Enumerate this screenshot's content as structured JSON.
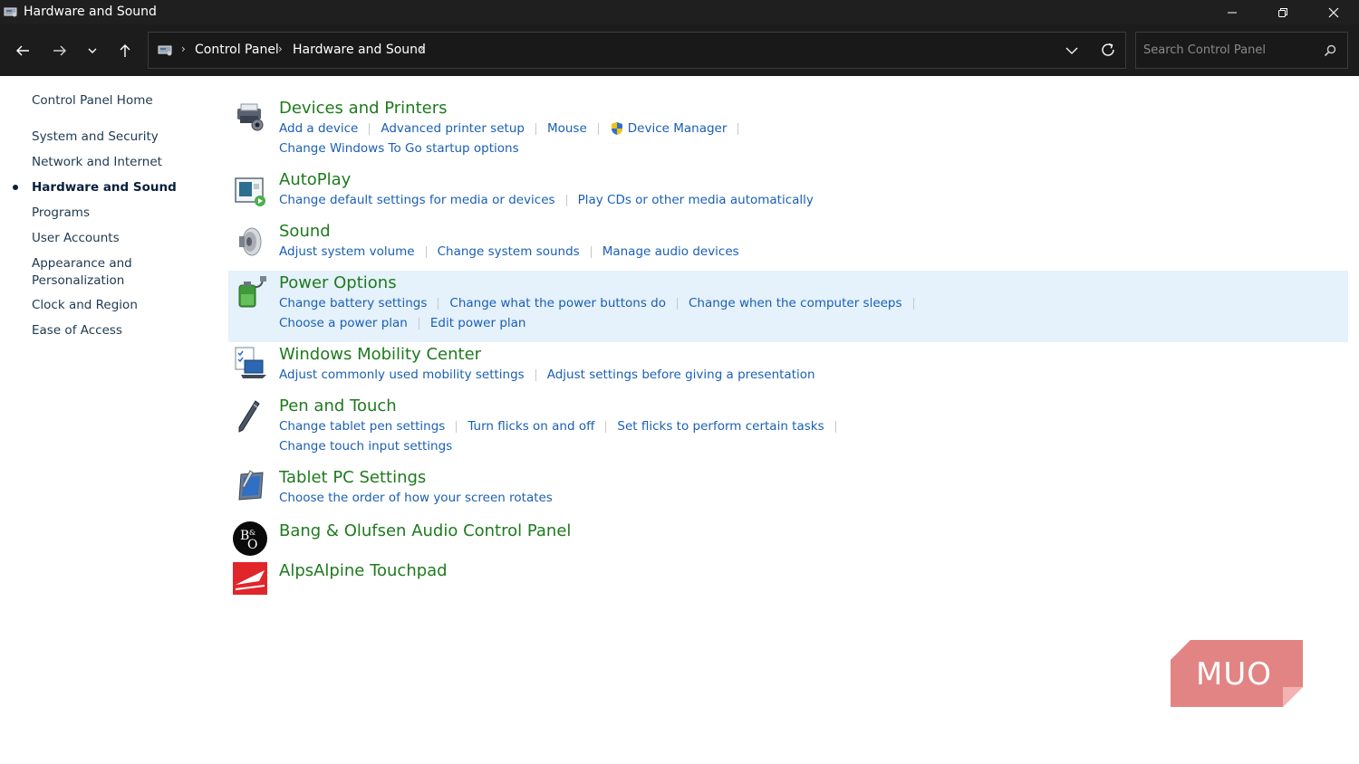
{
  "window": {
    "title": "Hardware and Sound",
    "controls": {
      "minimize": "minimize",
      "maximize": "restore",
      "close": "close"
    }
  },
  "address_bar": {
    "breadcrumbs": [
      "Control Panel",
      "Hardware and Sound"
    ],
    "search_placeholder": "Search Control Panel"
  },
  "sidebar": {
    "home": "Control Panel Home",
    "items": [
      {
        "label": "System and Security",
        "active": false
      },
      {
        "label": "Network and Internet",
        "active": false
      },
      {
        "label": "Hardware and Sound",
        "active": true
      },
      {
        "label": "Programs",
        "active": false
      },
      {
        "label": "User Accounts",
        "active": false
      },
      {
        "label": "Appearance and Personalization",
        "active": false
      },
      {
        "label": "Clock and Region",
        "active": false
      },
      {
        "label": "Ease of Access",
        "active": false
      }
    ]
  },
  "categories": [
    {
      "title": "Devices and Printers",
      "icon": "printer-camera-icon",
      "rows": [
        [
          "Add a device",
          "Advanced printer setup",
          "Mouse",
          "Device Manager"
        ],
        [
          "Change Windows To Go startup options"
        ]
      ]
    },
    {
      "title": "AutoPlay",
      "icon": "autoplay-icon",
      "rows": [
        [
          "Change default settings for media or devices",
          "Play CDs or other media automatically"
        ]
      ]
    },
    {
      "title": "Sound",
      "icon": "speaker-icon",
      "rows": [
        [
          "Adjust system volume",
          "Change system sounds",
          "Manage audio devices"
        ]
      ]
    },
    {
      "title": "Power Options",
      "icon": "battery-plug-icon",
      "highlighted": true,
      "rows": [
        [
          "Change battery settings",
          "Change what the power buttons do",
          "Change when the computer sleeps"
        ],
        [
          "Choose a power plan",
          "Edit power plan"
        ]
      ]
    },
    {
      "title": "Windows Mobility Center",
      "icon": "laptop-checklist-icon",
      "rows": [
        [
          "Adjust commonly used mobility settings",
          "Adjust settings before giving a presentation"
        ]
      ]
    },
    {
      "title": "Pen and Touch",
      "icon": "pen-icon",
      "rows": [
        [
          "Change tablet pen settings",
          "Turn flicks on and off",
          "Set flicks to perform certain tasks"
        ],
        [
          "Change touch input settings"
        ]
      ]
    },
    {
      "title": "Tablet PC Settings",
      "icon": "tablet-pen-icon",
      "rows": [
        [
          "Choose the order of how your screen rotates"
        ]
      ]
    },
    {
      "title": "Bang & Olufsen Audio Control Panel",
      "icon": "bang-olufsen-logo-icon",
      "rows": []
    },
    {
      "title": "AlpsAlpine Touchpad",
      "icon": "alpsalpine-logo-icon",
      "rows": []
    }
  ],
  "watermark": {
    "text": "MUO"
  },
  "colors": {
    "title_bar": "#1f1f1f",
    "category_title": "#1e7a1e",
    "task_link": "#1a5fb4",
    "sidebar_text": "#1e3950",
    "highlight": "#e5f1fb",
    "watermark": "#e06f6f"
  }
}
